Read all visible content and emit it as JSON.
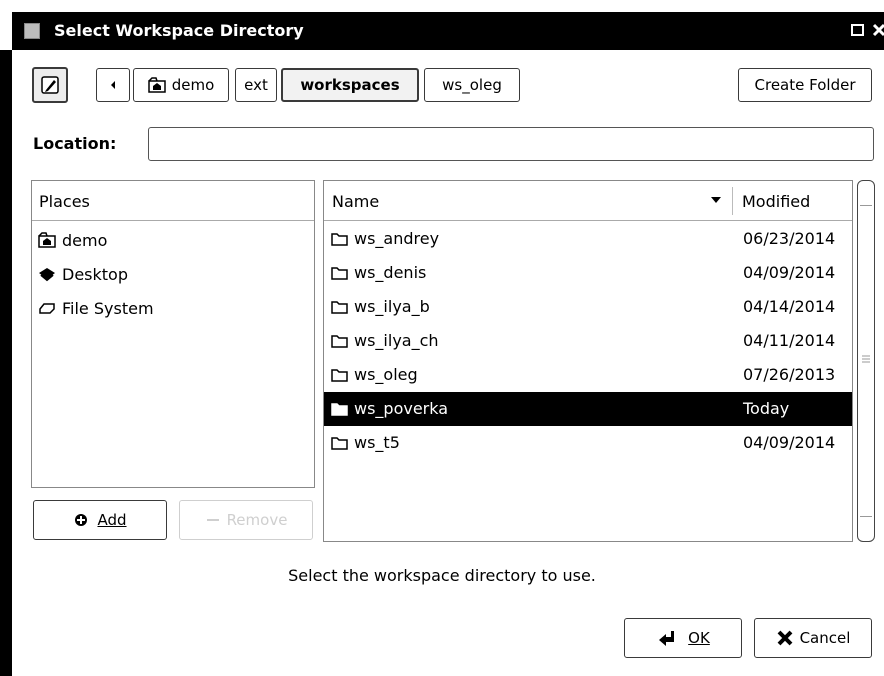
{
  "window": {
    "title": "Select Workspace Directory"
  },
  "toolbar": {
    "path": [
      "demo",
      "ext",
      "workspaces",
      "ws_oleg"
    ],
    "create_folder_label": "Create Folder"
  },
  "location": {
    "label": "Location:",
    "value": ""
  },
  "places": {
    "header": "Places",
    "items": [
      {
        "label": "demo",
        "icon": "home-folder-icon"
      },
      {
        "label": "Desktop",
        "icon": "desktop-icon"
      },
      {
        "label": "File System",
        "icon": "drive-icon"
      }
    ],
    "add_label": "Add",
    "remove_label": "Remove"
  },
  "files": {
    "col_name": "Name",
    "col_modified": "Modified",
    "rows": [
      {
        "name": "ws_andrey",
        "modified": "06/23/2014"
      },
      {
        "name": "ws_denis",
        "modified": "04/09/2014"
      },
      {
        "name": "ws_ilya_b",
        "modified": "04/14/2014"
      },
      {
        "name": "ws_ilya_ch",
        "modified": "04/11/2014"
      },
      {
        "name": "ws_oleg",
        "modified": "07/26/2013"
      },
      {
        "name": "ws_poverka",
        "modified": "Today",
        "selected": true
      },
      {
        "name": "ws_t5",
        "modified": "04/09/2014"
      }
    ]
  },
  "footer": {
    "help": "Select the workspace directory to use.",
    "ok_label": "OK",
    "cancel_label": "Cancel"
  }
}
